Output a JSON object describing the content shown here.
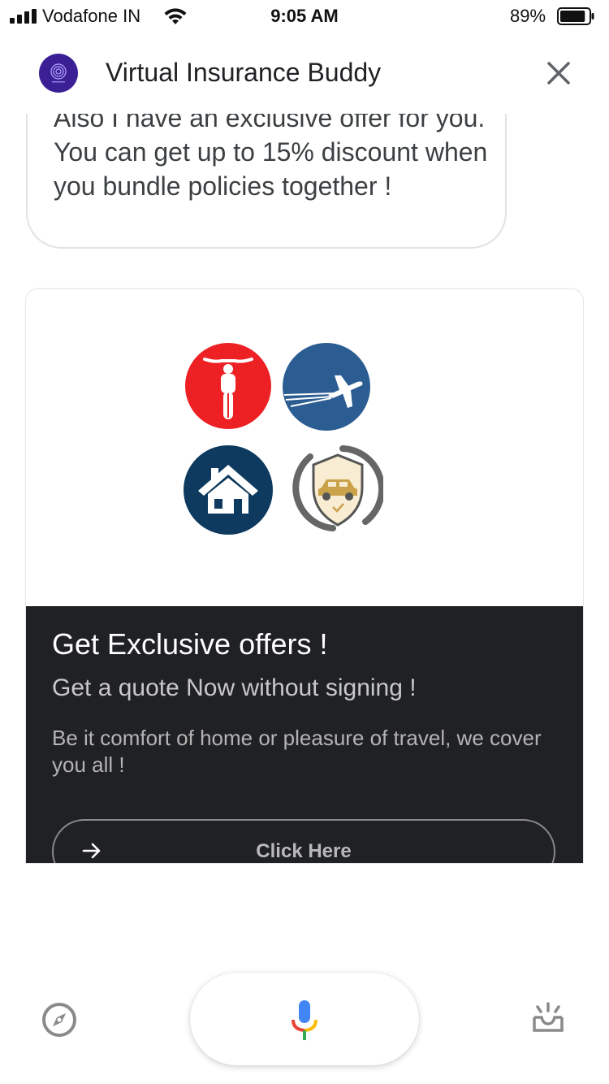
{
  "status_bar": {
    "carrier": "Vodafone IN",
    "time": "9:05 AM",
    "battery_percent": "89%",
    "battery_level": 0.89,
    "signal_icon": "signal-bars-icon",
    "wifi_icon": "wifi-icon"
  },
  "header": {
    "title": "Virtual Insurance Buddy",
    "avatar": "bot-avatar",
    "close_icon": "close-icon"
  },
  "chat": {
    "message": "Also I have an exclusive offer for you. You can get up to 15% discount when you bundle policies together !"
  },
  "card": {
    "image_icons": [
      "motorcycle-icon",
      "airplane-icon",
      "home-icon",
      "car-shield-icon"
    ],
    "title": "Get Exclusive offers !",
    "subtitle": "Get a quote Now without signing !",
    "description": "Be it comfort of home or pleasure of travel, we cover you all !",
    "button_label": "Click Here",
    "button_icon": "arrow-right-icon"
  },
  "bottom_bar": {
    "explore_icon": "compass-icon",
    "mic_icon": "microphone-icon",
    "snapshot_icon": "inbox-tray-icon"
  },
  "colors": {
    "accent_red": "#ed2024",
    "accent_blue": "#2c5d92",
    "dark_blue": "#0d3a5e",
    "card_dark": "#202124",
    "avatar_purple": "#3b1f95"
  }
}
